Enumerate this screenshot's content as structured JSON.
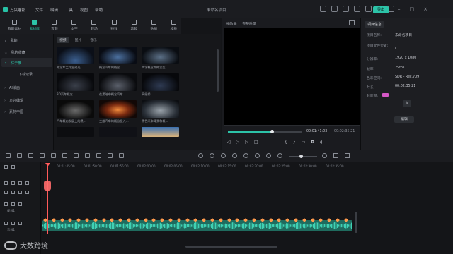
{
  "app": {
    "name": "万兴喵影",
    "window_title": "未命名项目",
    "export_label": "导出"
  },
  "menu": [
    "文件",
    "编辑",
    "工具",
    "视图",
    "帮助"
  ],
  "top_tabs": [
    {
      "label": "我的素材",
      "icon": "folder-icon"
    },
    {
      "label": "素材库",
      "icon": "library-icon"
    },
    {
      "label": "音频",
      "icon": "music-icon"
    },
    {
      "label": "文字",
      "icon": "text-icon"
    },
    {
      "label": "转场",
      "icon": "transition-icon"
    },
    {
      "label": "特效",
      "icon": "effects-icon"
    },
    {
      "label": "滤镜",
      "icon": "filter-icon"
    },
    {
      "label": "贴纸",
      "icon": "sticker-icon"
    },
    {
      "label": "模板",
      "icon": "template-icon"
    }
  ],
  "sidebar": {
    "items": [
      {
        "label": "我的"
      },
      {
        "label": "我的收藏"
      },
      {
        "label": "红于推"
      },
      {
        "label": "下载记录"
      },
      {
        "label": "AI绘画"
      },
      {
        "label": "万兴编辑"
      },
      {
        "label": "素材中国"
      }
    ]
  },
  "media": {
    "subtabs": [
      "视频",
      "图片",
      "音乐"
    ],
    "cards": [
      {
        "label": "概念车工作室幻光"
      },
      {
        "label": "概念汽车的概念"
      },
      {
        "label": "大学概念车概念生..."
      },
      {
        "label": "3D汽车概念"
      },
      {
        "label": "在黑暗中概念汽车..."
      },
      {
        "label": "高级轿"
      },
      {
        "label": "汽车概念发展上的黑..."
      },
      {
        "label": "三维汽车的概念投入..."
      },
      {
        "label": "黑色汽车背景和概..."
      },
      {
        "label": ""
      },
      {
        "label": ""
      },
      {
        "label": ""
      }
    ]
  },
  "player": {
    "mode": "播放器",
    "quality": "完整质量",
    "time_current": "00:01:41:03",
    "time_total": "00:02:35:21",
    "progress": 0.6
  },
  "properties": {
    "tab": "项目信息",
    "rows": [
      {
        "key": "项目名称:",
        "value": "未命名项目"
      },
      {
        "key": "项目文件位置:",
        "value": "/"
      },
      {
        "key": "分辨率:",
        "value": "1920 x 1080"
      },
      {
        "key": "帧率:",
        "value": "25fps"
      },
      {
        "key": "色彩空间:",
        "value": "SDR - Rec.709"
      },
      {
        "key": "时长:",
        "value": "00:02:35:21"
      },
      {
        "key": "封面图:",
        "value": ""
      }
    ],
    "edit_label": "编辑"
  },
  "timeline": {
    "ruler": [
      "00:01:45:00",
      "00:01:50:00",
      "00:01:55:00",
      "00:02:00:00",
      "00:02:05:00",
      "00:02:10:00",
      "00:02:15:00",
      "00:02:20:00",
      "00:02:25:00",
      "00:02:30:00",
      "00:02:35:00"
    ],
    "track_labels": [
      "视频1",
      "",
      "音频1"
    ],
    "audio_name": ""
  },
  "watermark": "大数跨境",
  "colors": {
    "accent": "#2cc3a8",
    "playhead": "#ff5a5a",
    "audio": "#1f6b5e"
  }
}
